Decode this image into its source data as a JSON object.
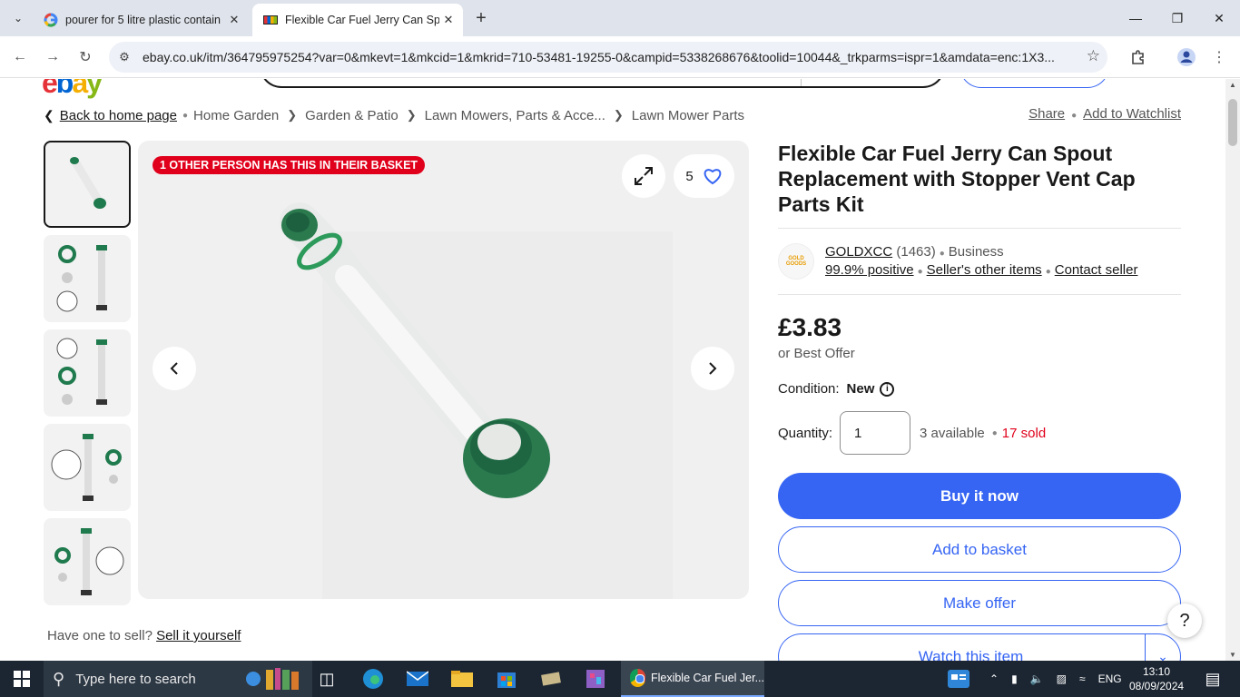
{
  "browser": {
    "tabs": [
      {
        "title": "pourer for 5 litre plastic contain",
        "active": false
      },
      {
        "title": "Flexible Car Fuel Jerry Can Spou",
        "active": true
      }
    ],
    "url": "ebay.co.uk/itm/364795975254?var=0&mkevt=1&mkcid=1&mkrid=710-53481-19255-0&campid=5338268676&toolid=10044&_trkparms=ispr=1&amdata=enc:1X3..."
  },
  "breadcrumb": {
    "back_label": "Back to home page",
    "items": [
      "Home Garden",
      "Garden & Patio",
      "Lawn Mowers, Parts & Acce...",
      "Lawn Mower Parts"
    ]
  },
  "actions": {
    "share": "Share",
    "watchlist": "Add to Watchlist"
  },
  "gallery": {
    "badge": "1 OTHER PERSON HAS THIS IN THEIR BASKET",
    "watch_count": "5"
  },
  "sell": {
    "prefix": "Have one to sell?",
    "link": "Sell it yourself"
  },
  "product": {
    "title": "Flexible Car Fuel Jerry Can Spout Replacement with Stopper Vent Cap Parts Kit",
    "price": "£3.83",
    "best_offer": "or Best Offer",
    "condition_label": "Condition:",
    "condition_value": "New",
    "quantity_label": "Quantity:",
    "quantity_value": "1",
    "available": "3 available",
    "sold": "17 sold"
  },
  "seller": {
    "logo_text": "GOLD GOODS",
    "name": "GOLDXCC",
    "count": "(1463)",
    "type": "Business",
    "positive": "99.9% positive",
    "other_items": "Seller's other items",
    "contact": "Contact seller"
  },
  "buttons": {
    "buy_now": "Buy it now",
    "add_basket": "Add to basket",
    "make_offer": "Make offer",
    "watch": "Watch this item"
  },
  "help": "?",
  "taskbar": {
    "search_placeholder": "Type here to search",
    "chrome_window": "Flexible Car Fuel Jer...",
    "lang": "ENG",
    "time": "13:10",
    "date": "08/09/2024"
  },
  "colors": {
    "accent": "#3665f3",
    "badge": "#e0001b",
    "sold": "#e0001b"
  }
}
